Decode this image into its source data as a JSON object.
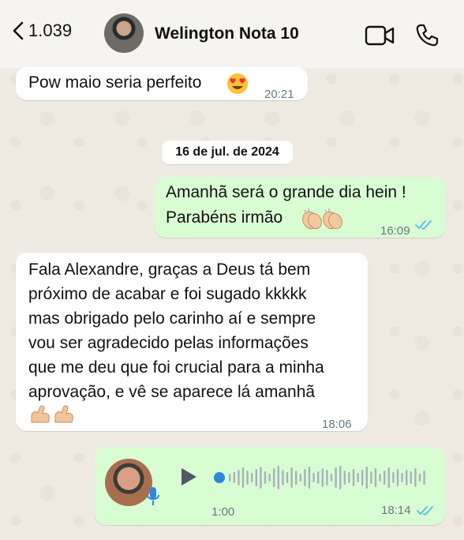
{
  "header": {
    "back_count": "1.039",
    "contact_name": "Welington Nota 10",
    "icons": [
      "chevron-left-icon",
      "video-call-icon",
      "phone-icon"
    ]
  },
  "messages": [
    {
      "direction": "incoming",
      "text": "Pow maio seria perfeito",
      "emoji": "heart-eyes",
      "time": "20:21"
    },
    {
      "direction": "outgoing",
      "lines": [
        "Amanhã será o grande dia hein !",
        "Parabéns irmão"
      ],
      "emoji": "clapping-hands",
      "time": "16:09",
      "status": "read"
    },
    {
      "direction": "incoming",
      "lines": [
        "Fala Alexandre, graças a Deus tá bem",
        "próximo de acabar e foi sugado kkkkk",
        "mas obrigado pelo carinho aí e sempre",
        "vou ser agradecido pelas informações",
        "que me deu que foi crucial para a minha",
        "aprovação, e vê se aparece lá amanhã"
      ],
      "emoji": "flexed-biceps",
      "time": "18:06"
    },
    {
      "direction": "outgoing",
      "type": "voice",
      "duration": "1:00",
      "time": "18:14",
      "status": "read"
    }
  ],
  "date_separator": "16 de jul. de 2024",
  "colors": {
    "outgoing": "#d9fdd3",
    "incoming": "#ffffff",
    "read_check": "#53bdeb",
    "wave": "#a7b2b8",
    "wave_played": "#2e88d9"
  }
}
